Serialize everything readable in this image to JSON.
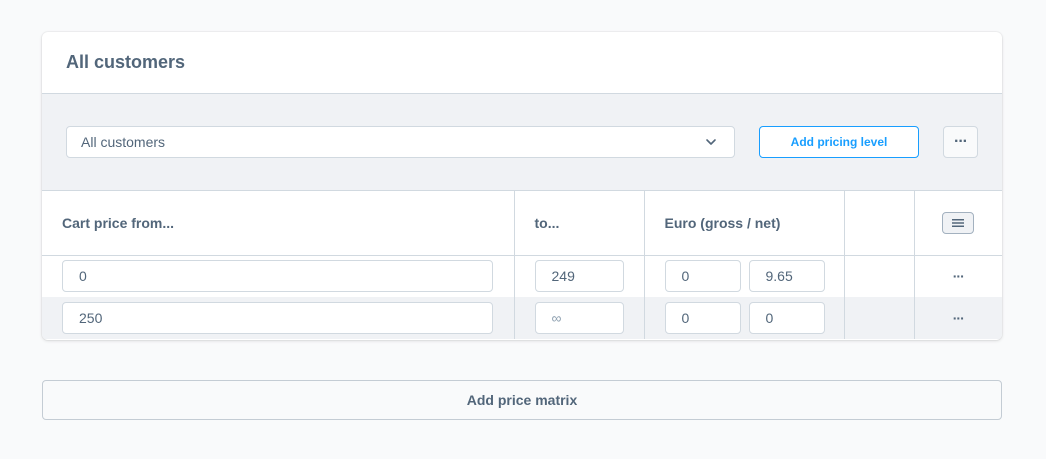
{
  "card": {
    "title": "All customers"
  },
  "toolbar": {
    "rule_select_value": "All customers",
    "add_pricing_level_label": "Add pricing level",
    "more_label": "···"
  },
  "table": {
    "headers": [
      "Cart price from...",
      "to...",
      "Euro (gross / net)"
    ],
    "rows": [
      {
        "from": "0",
        "to": "249",
        "gross": "0",
        "net": "9.65",
        "actions": "···"
      },
      {
        "from": "250",
        "to": "∞",
        "gross": "0",
        "net": "0",
        "actions": "···"
      }
    ]
  },
  "footer": {
    "add_price_matrix_label": "Add price matrix"
  },
  "colors": {
    "accent": "#189eff",
    "text": "#52667a",
    "border": "#d1d9e0",
    "toolbar_bg": "#f0f2f5"
  }
}
